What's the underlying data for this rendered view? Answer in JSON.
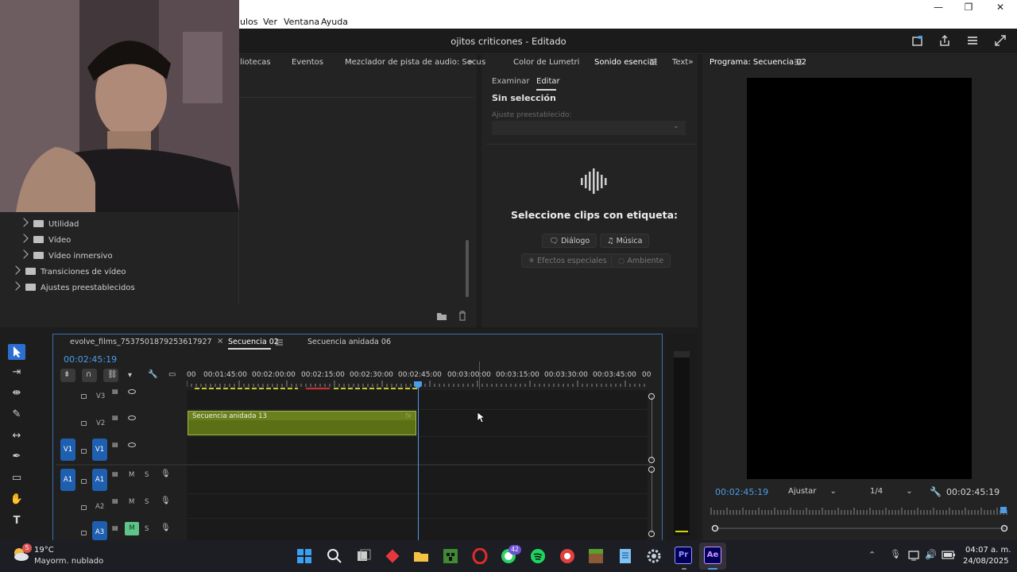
{
  "window": {
    "title": "ojitos criticones - Editado",
    "menu": [
      "ulos",
      "Ver",
      "Ventana",
      "Ayuda"
    ],
    "controls": {
      "minimize": "—",
      "restore": "❐",
      "close": "✕"
    }
  },
  "top_tabs": {
    "left": [
      "liotecas",
      "Eventos",
      "Mezclador de pista de audio: Secuenc"
    ],
    "middle": [
      "s",
      "Color de Lumetri",
      "Sonido esencial",
      "Text"
    ],
    "program": "Programa: Secuencia 02"
  },
  "project_tree": {
    "items": [
      {
        "label": "Utilidad",
        "level": 1
      },
      {
        "label": "Vídeo",
        "level": 1
      },
      {
        "label": "Vídeo inmersivo",
        "level": 1
      },
      {
        "label": "Transiciones de vídeo",
        "level": 0
      },
      {
        "label": "Ajustes preestablecidos",
        "level": 0
      }
    ]
  },
  "essential_sound": {
    "tabs": [
      "Examinar",
      "Editar"
    ],
    "active_tab": "Editar",
    "no_selection": "Sin selección",
    "preset_label": "Ajuste preestablecido:",
    "prompt": "Seleccione clips con etiqueta:",
    "buttons": [
      {
        "label": "Diálogo",
        "enabled": true
      },
      {
        "label": "Música",
        "enabled": true
      },
      {
        "label": "Efectos especiales",
        "enabled": false
      },
      {
        "label": "Ambiente",
        "enabled": false
      }
    ]
  },
  "timeline": {
    "tabs": [
      "evolve_films_7537501879253617927",
      "Secuencia 02",
      "Secuencia anidada 06"
    ],
    "active_tab": "Secuencia 02",
    "close_glyph": "×",
    "timecode": "00:02:45:19",
    "ruler": [
      "00",
      "00:01:45:00",
      "00:02:00:00",
      "00:02:15:00",
      "00:02:30:00",
      "00:02:45:00",
      "00:03:00:00",
      "00:03:15:00",
      "00:03:30:00",
      "00:03:45:00",
      "00"
    ],
    "tracks": {
      "video": [
        "V3",
        "V2",
        "V1"
      ],
      "audio": [
        "A1",
        "A2",
        "A3"
      ],
      "source_v": "V1",
      "source_a": "A1",
      "mute": "M",
      "solo": "S"
    },
    "clip": {
      "label": "Secuencia anidada 13",
      "fx": "fx",
      "color": "#5b6f14"
    }
  },
  "program_monitor": {
    "timecode_left": "00:02:45:19",
    "fit": "Ajustar",
    "resolution": "1/4",
    "timecode_right": "00:02:45:19"
  },
  "taskbar": {
    "weather_temp": "19°C",
    "weather_desc": "Mayorm. nublado",
    "weather_badge": "5",
    "whatsapp_badge": "42",
    "time": "04:07 a. m.",
    "date": "24/08/2025",
    "apps": [
      "start",
      "search",
      "task-view",
      "git",
      "file-explorer",
      "minecraft",
      "opera",
      "whatsapp",
      "spotify",
      "chrome",
      "minecraft-block",
      "notepad",
      "settings",
      "premiere-pro",
      "after-effects"
    ],
    "pr": "Pr",
    "ae": "Ae"
  },
  "colors": {
    "accent": "#4a9de8",
    "track_blue": "#1f5fb0",
    "clip_green": "#5b6f14"
  }
}
